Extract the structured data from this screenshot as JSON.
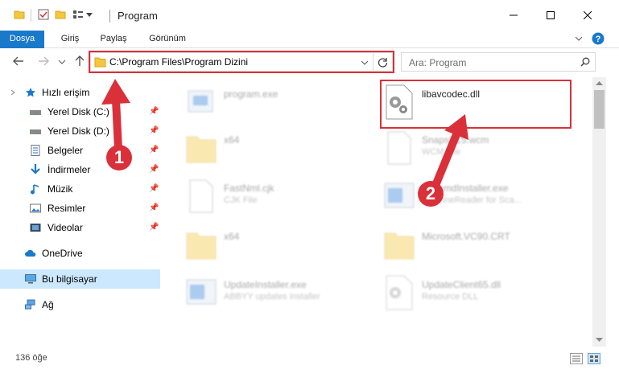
{
  "window": {
    "title": "Program"
  },
  "ribbon": {
    "tabs": [
      {
        "label": "Dosya"
      },
      {
        "label": "Giriş"
      },
      {
        "label": "Paylaş"
      },
      {
        "label": "Görünüm"
      }
    ]
  },
  "address": {
    "path": "C:\\Program Files\\Program Dizini",
    "search_placeholder": "Ara: Program"
  },
  "nav": {
    "quick_access": "Hızlı erişim",
    "items": [
      {
        "label": "Yerel Disk (C:)",
        "icon": "drive-icon"
      },
      {
        "label": "Yerel Disk (D:)",
        "icon": "drive-icon"
      },
      {
        "label": "Belgeler",
        "icon": "documents-icon"
      },
      {
        "label": "İndirmeler",
        "icon": "downloads-icon"
      },
      {
        "label": "Müzik",
        "icon": "music-icon"
      },
      {
        "label": "Resimler",
        "icon": "pictures-icon"
      },
      {
        "label": "Videolar",
        "icon": "videos-icon"
      }
    ],
    "onedrive": "OneDrive",
    "this_pc": "Bu bilgisayar",
    "network": "Ağ"
  },
  "files": {
    "left": [
      {
        "name": "program.exe",
        "sub": ""
      },
      {
        "name": "x64",
        "sub": ""
      },
      {
        "name": "FastNml.cjk",
        "sub": "CJK File"
      },
      {
        "name": "x64",
        "sub": ""
      },
      {
        "name": "UpdateInstaller.exe",
        "sub": "ABBYY updates installer"
      }
    ],
    "right": [
      {
        "name": "libavcodec.dll",
        "sub": ""
      },
      {
        "name": "SnapsP15.wcm",
        "sub": "WCM File"
      },
      {
        "name": "...ammdInstaller.exe",
        "sub": "...Y FineReader for Sca..."
      },
      {
        "name": "Microsoft.VC90.CRT",
        "sub": ""
      },
      {
        "name": "UpdateClient65.dll",
        "sub": "Resource DLL"
      }
    ]
  },
  "status": {
    "count": "136 öğe"
  },
  "annotations": {
    "step1": "1",
    "step2": "2"
  },
  "colors": {
    "accent": "#1979ca",
    "highlight": "#d9303a",
    "selected": "#cce8ff"
  }
}
